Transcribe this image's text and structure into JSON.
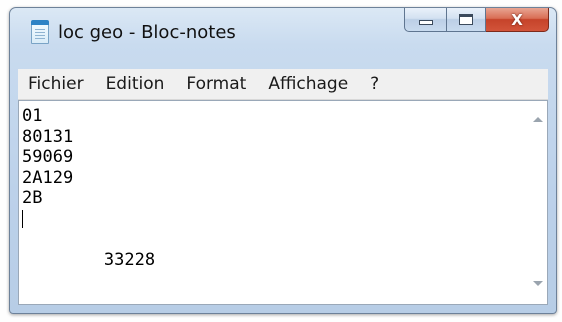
{
  "window": {
    "title": "loc geo - Bloc-notes",
    "icon": "notepad-icon"
  },
  "caption_buttons": {
    "minimize_icon": "minimize-icon",
    "maximize_icon": "maximize-icon",
    "close_icon": "close-icon",
    "close_glyph": "X"
  },
  "menu": {
    "items": [
      "Fichier",
      "Edition",
      "Format",
      "Affichage",
      "?"
    ]
  },
  "editor": {
    "lines": [
      "01",
      "80131",
      "59069",
      "2A129",
      "2B",
      "33228"
    ]
  },
  "colors": {
    "close_button": "#c6432a",
    "titlebar": "#c9dbef"
  }
}
